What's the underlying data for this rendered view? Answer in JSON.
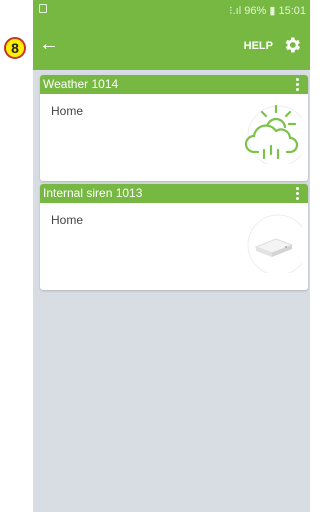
{
  "status_bar": {
    "battery": "96%",
    "time": "15:01"
  },
  "header": {
    "help_label": "HELP"
  },
  "step_badge": "8",
  "devices": [
    {
      "name": "Weather 1014",
      "location": "Home",
      "icon": "weather-cloud-sun-rain-icon"
    },
    {
      "name": "Internal siren 1013",
      "location": "Home",
      "icon": "siren-device-icon"
    }
  ],
  "colors": {
    "accent": "#76b842",
    "background": "#d8dde3",
    "badge_fill": "#ffee00",
    "badge_border": "#c0392b"
  }
}
